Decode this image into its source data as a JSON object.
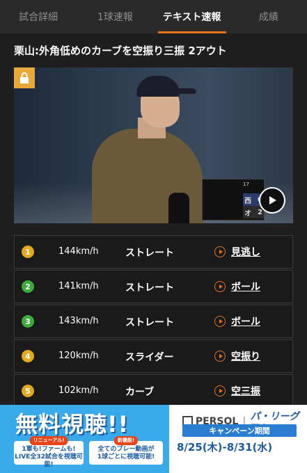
{
  "tabs": [
    {
      "label": "試合詳細"
    },
    {
      "label": "1球速報"
    },
    {
      "label": "テキスト速報",
      "active": true
    },
    {
      "label": "成績"
    }
  ],
  "headline": "栗山:外角低めのカーブを空振り三振 2アウト",
  "video": {
    "locked": true,
    "scoreboard": {
      "inning": "17",
      "teams": [
        {
          "abbr": "西",
          "score": "0"
        },
        {
          "abbr": "オ",
          "score": "2"
        }
      ]
    }
  },
  "pitches": [
    {
      "num": "1",
      "speed": "144km/h",
      "type": "ストレート",
      "result": "見逃し",
      "color": "#e0a81a"
    },
    {
      "num": "2",
      "speed": "141km/h",
      "type": "ストレート",
      "result": "ボール",
      "color": "#3caa3c"
    },
    {
      "num": "3",
      "speed": "143km/h",
      "type": "ストレート",
      "result": "ボール",
      "color": "#3caa3c"
    },
    {
      "num": "4",
      "speed": "120km/h",
      "type": "スライダー",
      "result": "空振り",
      "color": "#e0a81a"
    },
    {
      "num": "5",
      "speed": "102km/h",
      "type": "カーブ",
      "result": "空三振",
      "color": "#e0a81a"
    }
  ],
  "banner": {
    "title": "無料視聴!!",
    "box1_tag": "リニューアル!",
    "box1_line1": "1軍も!ファームも!",
    "box1_line2": "LIVE全32試合を視聴可能!",
    "box2_tag": "新機能!",
    "box2_line1": "全てのプレー動画が",
    "box2_line2": "1球ごとに視聴可能!",
    "brand": "PERSOL",
    "brand2": "パ・リーグTV",
    "campaign": "キャンペーン期間",
    "dates": "8/25(木)-8/31(水)"
  },
  "colors": {
    "accent": "#e8731a",
    "background": "#1f1f1f"
  }
}
